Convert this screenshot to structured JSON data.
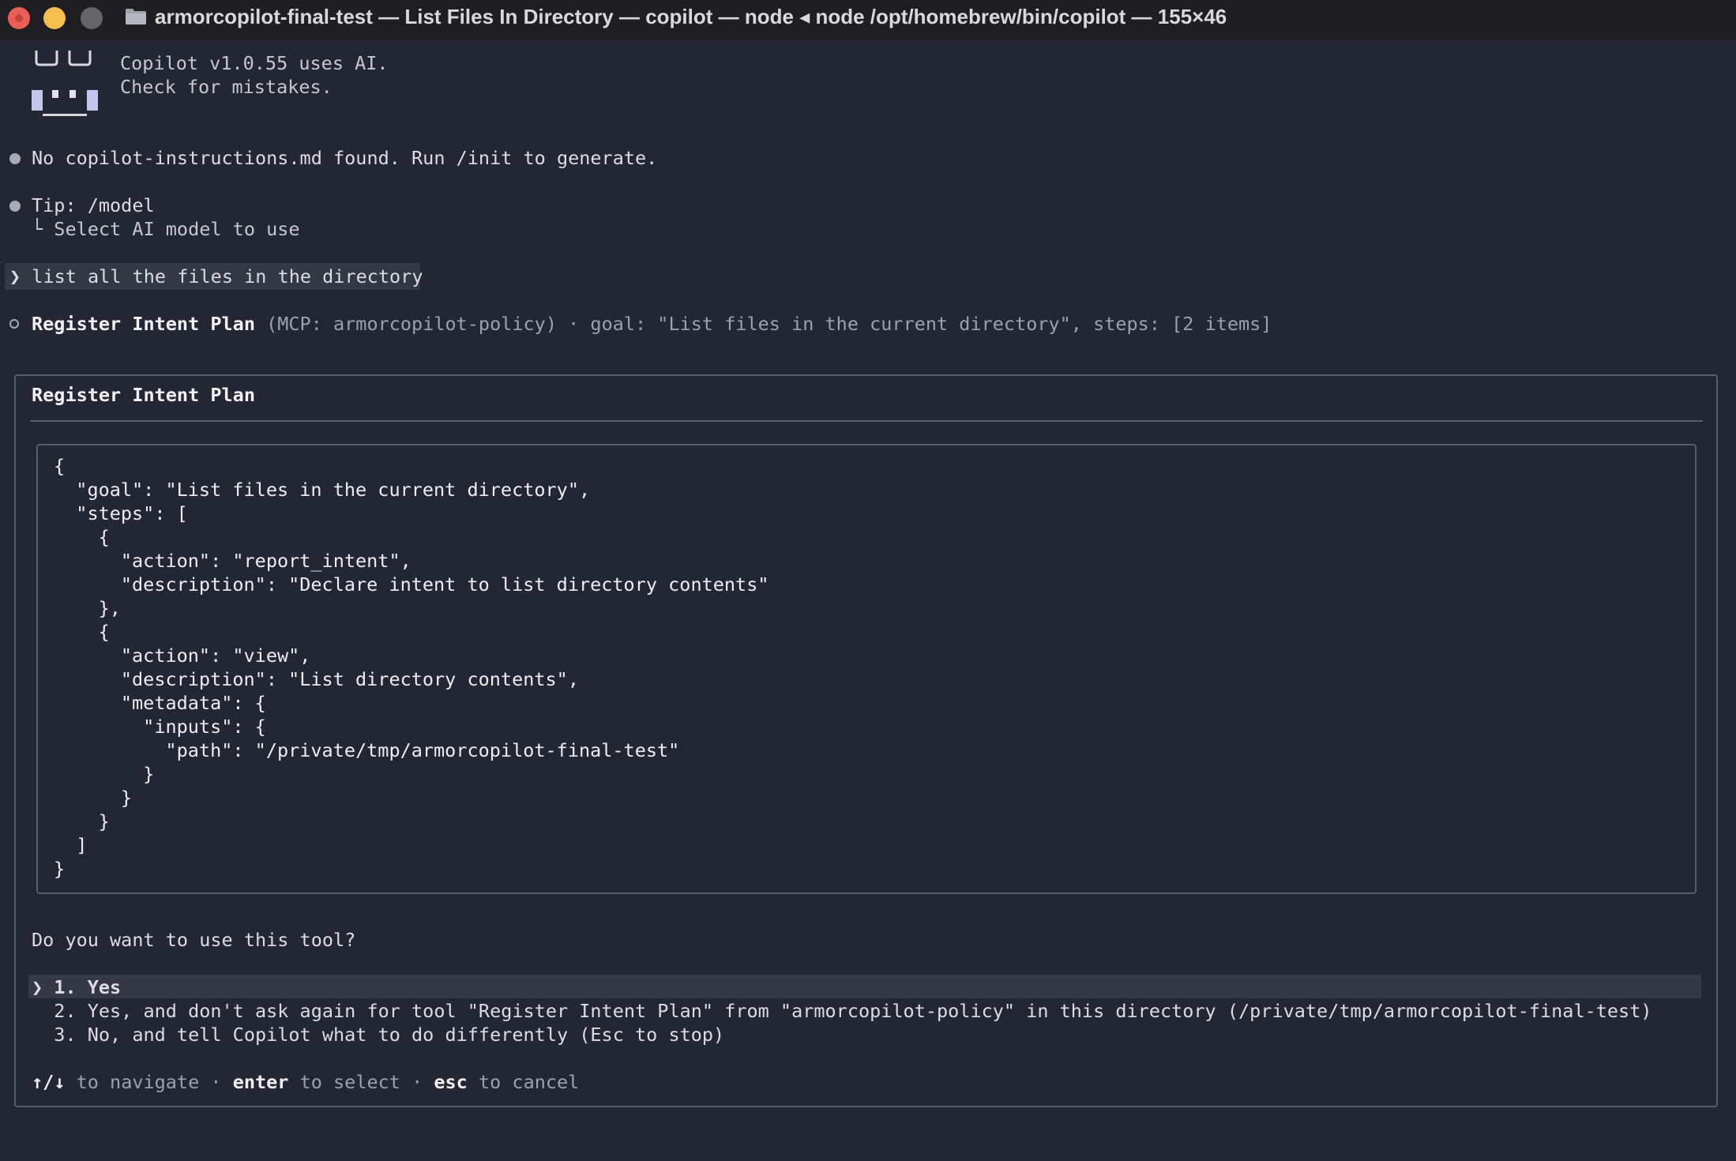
{
  "window": {
    "title": "armorcopilot-final-test — List Files In Directory — copilot — node ◂ node /opt/homebrew/bin/copilot — 155×46"
  },
  "banner": {
    "line1": "Copilot v1.0.55 uses AI.",
    "line2": "Check for mistakes."
  },
  "messages": {
    "no_instructions": "No copilot-instructions.md found. Run /init to generate.",
    "tip_title": "Tip: /model",
    "tip_detail": "└ Select AI model to use",
    "user_prompt": "❯ list all the files in the directory"
  },
  "tool_call": {
    "name": "Register Intent Plan",
    "meta": " (MCP: armorcopilot-policy) · goal: \"List files in the current directory\", steps: [2 items]"
  },
  "dialog": {
    "title": "Register Intent Plan",
    "code_lines": [
      "{",
      "  \"goal\": \"List files in the current directory\",",
      "  \"steps\": [",
      "    {",
      "      \"action\": \"report_intent\",",
      "      \"description\": \"Declare intent to list directory contents\"",
      "    },",
      "    {",
      "      \"action\": \"view\",",
      "      \"description\": \"List directory contents\",",
      "      \"metadata\": {",
      "        \"inputs\": {",
      "          \"path\": \"/private/tmp/armorcopilot-final-test\"",
      "        }",
      "      }",
      "    }",
      "  ]",
      "}"
    ],
    "question": "Do you want to use this tool?",
    "options": [
      "❯ 1. Yes",
      "  2. Yes, and don't ask again for tool \"Register Intent Plan\" from \"armorcopilot-policy\" in this directory (/private/tmp/armorcopilot-final-test)",
      "  3. No, and tell Copilot what to do differently (Esc to stop)"
    ],
    "hint": {
      "nav_keys": "↑/↓",
      "nav_text": " to navigate · ",
      "enter_key": "enter",
      "enter_text": " to select · ",
      "esc_key": "esc",
      "esc_text": " to cancel"
    }
  }
}
